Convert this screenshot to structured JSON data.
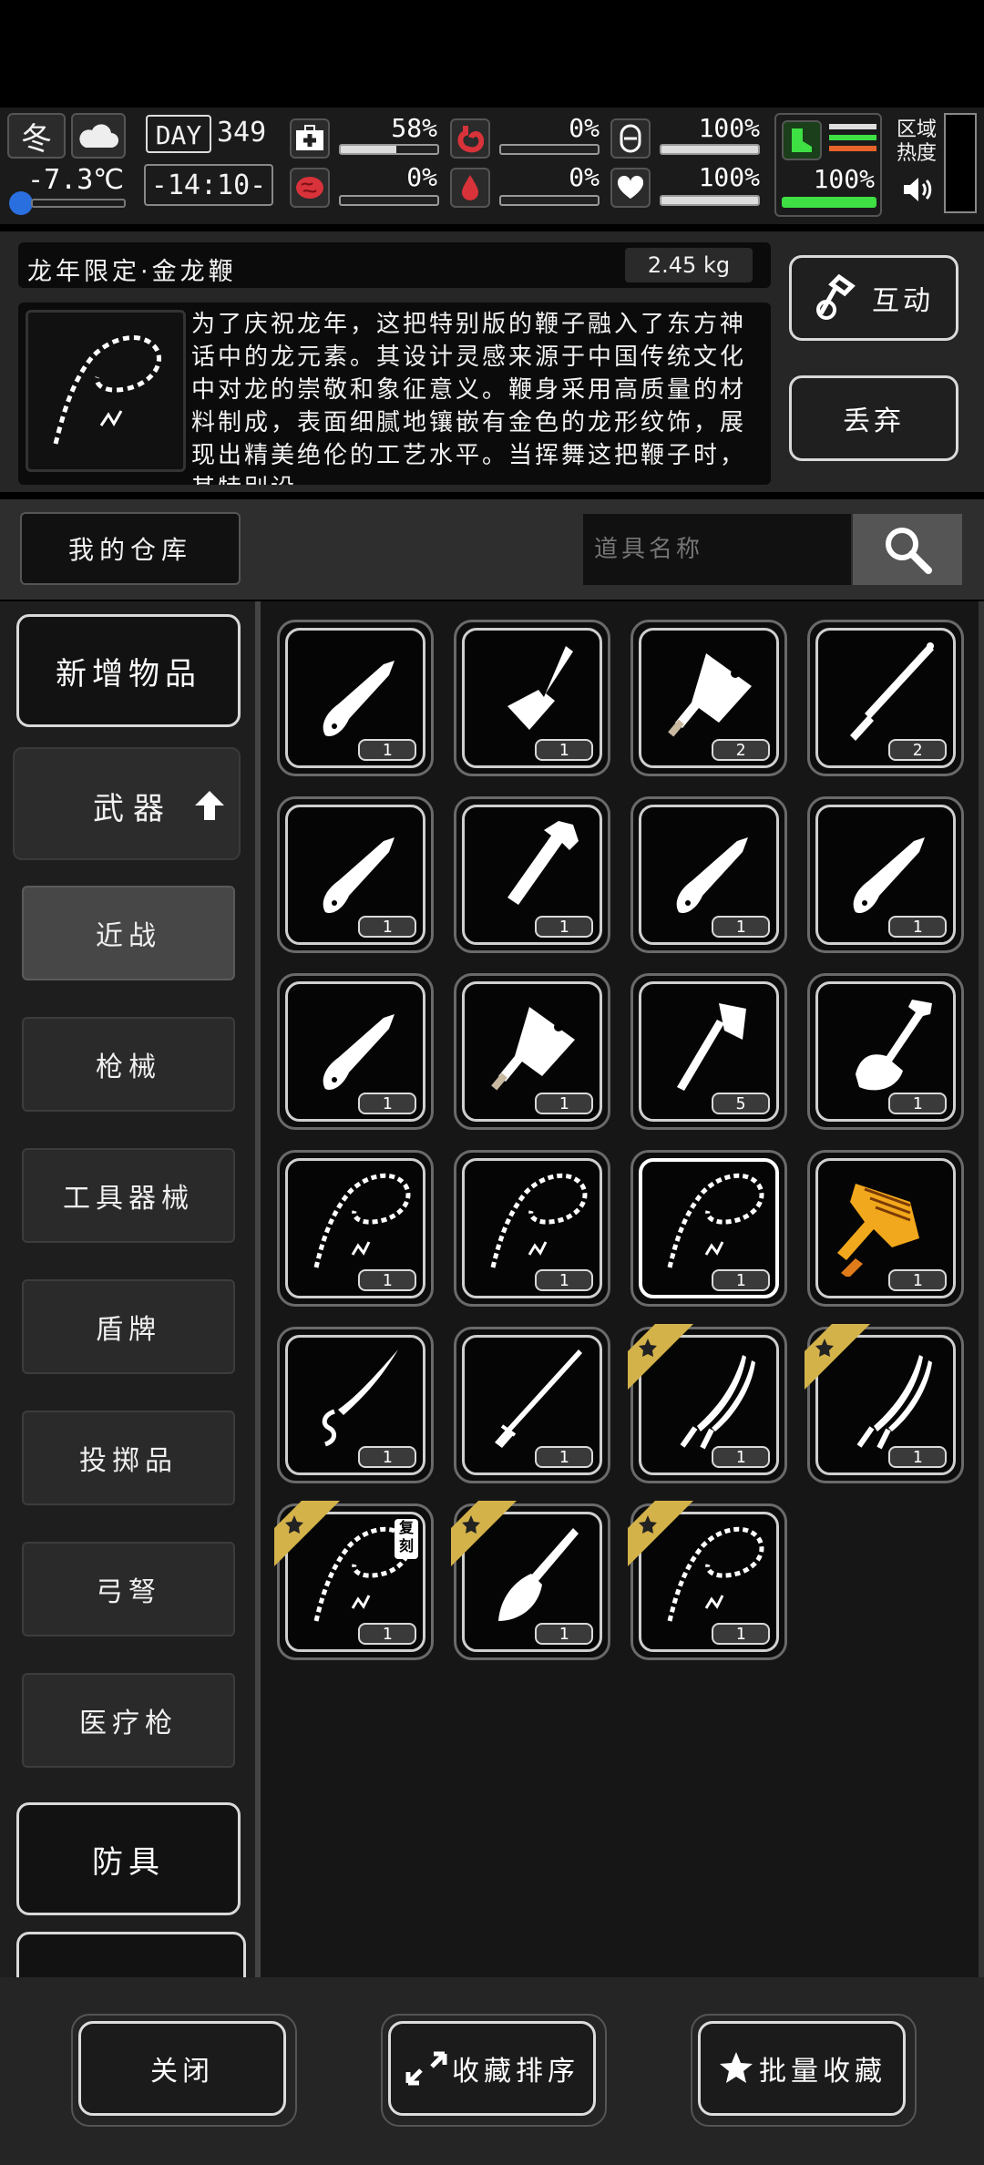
{
  "status": {
    "season": "冬",
    "temperature": "-7.3℃",
    "day_label": "DAY",
    "day_number": "349",
    "time": "-14:10-",
    "health_pct": "58%",
    "hunger_pct": "0%",
    "stamina_pct": "100%",
    "infection_pct": "0%",
    "thirst_pct": "0%",
    "mood_pct": "100%",
    "move_pct": "100%",
    "zone_heat_label": "区域热度",
    "levels": {
      "health": 0.58,
      "hunger": 0,
      "stamina": 1,
      "infection": 0,
      "thirst": 0,
      "mood": 1,
      "move": 1
    }
  },
  "item": {
    "name": "龙年限定·金龙鞭",
    "weight": "2.45 kg",
    "description": "为了庆祝龙年，这把特别版的鞭子融入了东方神话中的龙元素。其设计灵感来源于中国传统文化中对龙的崇敬和象征意义。鞭身采用高质量的材料制成，表面细腻地镶嵌有金色的龙形纹饰，展现出精美绝伦的工艺水平。当挥舞这把鞭子时，其特别设"
  },
  "actions": {
    "interact": "互动",
    "discard": "丢弃"
  },
  "warehouse": {
    "title": "我的仓库",
    "search_placeholder": "道具名称"
  },
  "categories": {
    "new_items": "新增物品",
    "weapons": "武器",
    "sub": [
      "近战",
      "枪械",
      "工具器械",
      "盾牌",
      "投掷品",
      "弓弩",
      "医疗枪"
    ],
    "armor": "防具"
  },
  "grid": [
    {
      "icon": "knife-icon",
      "count": "1"
    },
    {
      "icon": "spatula-icon",
      "count": "1"
    },
    {
      "icon": "cleaver-icon",
      "count": "2"
    },
    {
      "icon": "baton-icon",
      "count": "2"
    },
    {
      "icon": "knife-icon",
      "count": "1"
    },
    {
      "icon": "pipe-wrench-icon",
      "count": "1"
    },
    {
      "icon": "knife-icon",
      "count": "1"
    },
    {
      "icon": "knife-icon",
      "count": "1"
    },
    {
      "icon": "knife-icon",
      "count": "1"
    },
    {
      "icon": "cleaver-icon",
      "count": "1"
    },
    {
      "icon": "axe-icon",
      "count": "5"
    },
    {
      "icon": "shovel-icon",
      "count": "1"
    },
    {
      "icon": "dragon-whip-icon",
      "count": "1"
    },
    {
      "icon": "dragon-whip-icon",
      "count": "1"
    },
    {
      "icon": "dragon-whip-icon",
      "count": "1",
      "selected": true
    },
    {
      "icon": "golden-hammer-icon",
      "count": "1"
    },
    {
      "icon": "dragon-blade-icon",
      "count": "1"
    },
    {
      "icon": "katana-icon",
      "count": "1"
    },
    {
      "icon": "twin-katana-icon",
      "count": "1",
      "favorite": true
    },
    {
      "icon": "twin-katana-icon",
      "count": "1",
      "favorite": true
    },
    {
      "icon": "dragon-whip-icon",
      "count": "1",
      "favorite": true,
      "tag": "复刻"
    },
    {
      "icon": "spade-icon",
      "count": "1",
      "favorite": true
    },
    {
      "icon": "dragon-whip-icon",
      "count": "1",
      "favorite": true
    }
  ],
  "bottom": {
    "close": "关闭",
    "sort_favorites": "收藏排序",
    "batch_favorite": "批量收藏"
  }
}
